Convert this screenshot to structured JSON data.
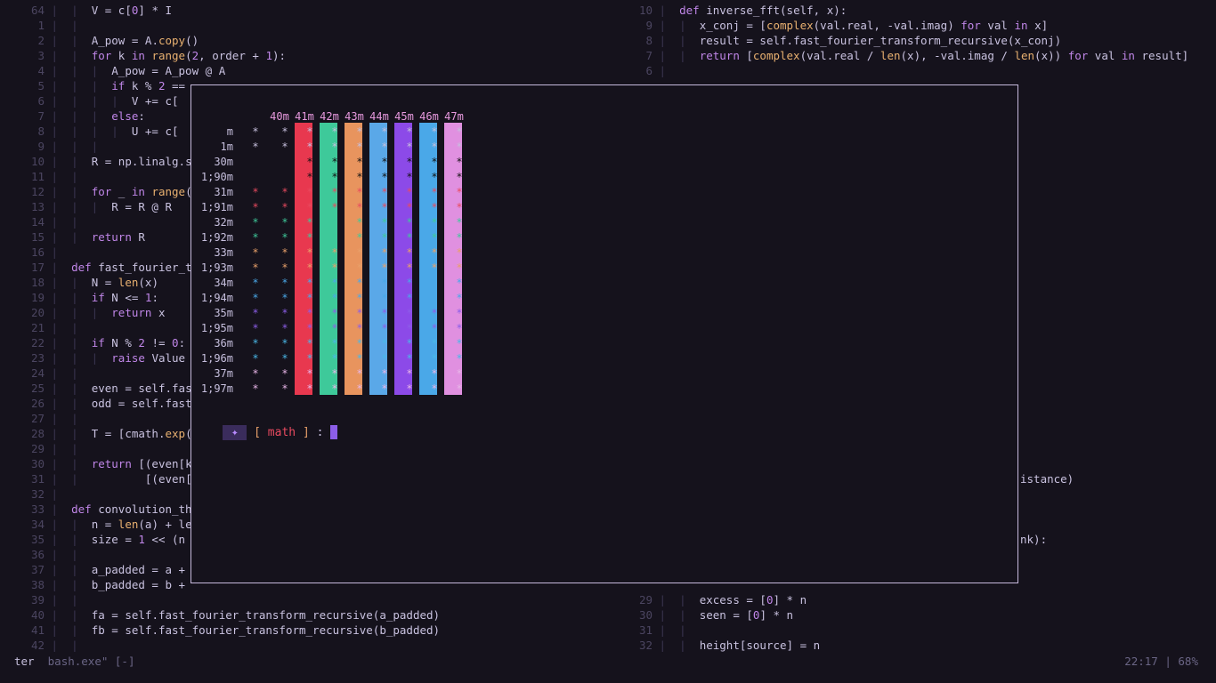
{
  "editor_left": {
    "lines": [
      {
        "n": "64",
        "indent": 1,
        "text": "V = c[0] * I"
      },
      {
        "n": "1",
        "indent": 1,
        "text": ""
      },
      {
        "n": "2",
        "indent": 1,
        "text": "A_pow = A.copy()"
      },
      {
        "n": "3",
        "indent": 1,
        "text": "for k in range(2, order + 1):"
      },
      {
        "n": "4",
        "indent": 2,
        "text": "A_pow = A_pow @ A"
      },
      {
        "n": "5",
        "indent": 2,
        "text": "if k % 2 =="
      },
      {
        "n": "6",
        "indent": 3,
        "text": "V += c["
      },
      {
        "n": "7",
        "indent": 2,
        "text": "else:"
      },
      {
        "n": "8",
        "indent": 3,
        "text": "U += c["
      },
      {
        "n": "9",
        "indent": 2,
        "text": ""
      },
      {
        "n": "10",
        "indent": 1,
        "text": "R = np.linalg.s"
      },
      {
        "n": "11",
        "indent": 1,
        "text": ""
      },
      {
        "n": "12",
        "indent": 1,
        "text": "for _ in range("
      },
      {
        "n": "13",
        "indent": 2,
        "text": "R = R @ R"
      },
      {
        "n": "14",
        "indent": 1,
        "text": ""
      },
      {
        "n": "15",
        "indent": 1,
        "text": "return R"
      },
      {
        "n": "16",
        "indent": 0,
        "text": ""
      },
      {
        "n": "17",
        "indent": 0,
        "text": "def fast_fourier_tr"
      },
      {
        "n": "18",
        "indent": 1,
        "text": "N = len(x)"
      },
      {
        "n": "19",
        "indent": 1,
        "text": "if N <= 1:"
      },
      {
        "n": "20",
        "indent": 2,
        "text": "return x"
      },
      {
        "n": "21",
        "indent": 1,
        "text": ""
      },
      {
        "n": "22",
        "indent": 1,
        "text": "if N % 2 != 0:"
      },
      {
        "n": "23",
        "indent": 2,
        "text": "raise Value"
      },
      {
        "n": "24",
        "indent": 1,
        "text": ""
      },
      {
        "n": "25",
        "indent": 1,
        "text": "even = self.fas"
      },
      {
        "n": "26",
        "indent": 1,
        "text": "odd = self.fast"
      },
      {
        "n": "27",
        "indent": 1,
        "text": ""
      },
      {
        "n": "28",
        "indent": 1,
        "text": "T = [cmath.exp("
      },
      {
        "n": "29",
        "indent": 1,
        "text": ""
      },
      {
        "n": "30",
        "indent": 1,
        "text": "return [(even[k"
      },
      {
        "n": "31",
        "indent": 1,
        "text": "        [(even[k"
      },
      {
        "n": "32",
        "indent": 0,
        "text": ""
      },
      {
        "n": "33",
        "indent": 0,
        "text": "def convolution_the"
      },
      {
        "n": "34",
        "indent": 1,
        "text": "n = len(a) + le"
      },
      {
        "n": "35",
        "indent": 1,
        "text": "size = 1 << (n"
      },
      {
        "n": "36",
        "indent": 1,
        "text": ""
      },
      {
        "n": "37",
        "indent": 1,
        "text": "a_padded = a +"
      },
      {
        "n": "38",
        "indent": 1,
        "text": "b_padded = b +"
      },
      {
        "n": "39",
        "indent": 1,
        "text": ""
      },
      {
        "n": "40",
        "indent": 1,
        "text": "fa = self.fast_fourier_transform_recursive(a_padded)"
      },
      {
        "n": "41",
        "indent": 1,
        "text": "fb = self.fast_fourier_transform_recursive(b_padded)"
      },
      {
        "n": "42",
        "indent": 1,
        "text": ""
      }
    ]
  },
  "editor_right": {
    "lines": [
      {
        "n": "10",
        "indent": 0,
        "text": "def inverse_fft(self, x):"
      },
      {
        "n": "9",
        "indent": 1,
        "text": "x_conj = [complex(val.real, -val.imag) for val in x]"
      },
      {
        "n": "8",
        "indent": 1,
        "text": "result = self.fast_fourier_transform_recursive(x_conj)"
      },
      {
        "n": "7",
        "indent": 1,
        "text": "return [complex(val.real / len(x), -val.imag / len(x)) for val in result]"
      },
      {
        "n": "6",
        "indent": 0,
        "text": ""
      }
    ],
    "fragments": [
      {
        "line": 31,
        "text": "istance)"
      },
      {
        "line": 35,
        "text": "nk):"
      }
    ],
    "bottom_lines": [
      {
        "n": "29",
        "indent": 1,
        "text": "excess = [0] * n"
      },
      {
        "n": "30",
        "indent": 1,
        "text": "seen = [0] * n"
      },
      {
        "n": "31",
        "indent": 1,
        "text": ""
      },
      {
        "n": "32",
        "indent": 1,
        "text": "height[source] = n"
      }
    ]
  },
  "color_test": {
    "column_headers": [
      "40m",
      "41m",
      "42m",
      "43m",
      "44m",
      "45m",
      "46m",
      "47m"
    ],
    "row_labels": [
      "m",
      "1m",
      "30m",
      "1;90m",
      "31m",
      "1;91m",
      "32m",
      "1;92m",
      "33m",
      "1;93m",
      "34m",
      "1;94m",
      "35m",
      "1;95m",
      "36m",
      "1;96m",
      "37m",
      "1;97m"
    ],
    "glyph": "*",
    "fg_colors": [
      "#c6bfdd",
      "#c6bfdd",
      "#111111",
      "#111111",
      "#e84a5f",
      "#e84a5f",
      "#3ec99a",
      "#3ec99a",
      "#e8a06a",
      "#e8a06a",
      "#4aa8e8",
      "#4aa8e8",
      "#8c5ee8",
      "#8c5ee8",
      "#4ab8e8",
      "#4ab8e8",
      "#e8b6e8",
      "#e8b6e8"
    ],
    "bg_colors": [
      "",
      "#e8384f",
      "#3ec99a",
      "#e8945e",
      "#5aa8e8",
      "#8c4ae8",
      "#4aa8e8",
      "#e090e0"
    ]
  },
  "prompt": {
    "icon": "sparkle-icon",
    "symbol": "✦",
    "open": "[",
    "name": "math",
    "close": "]",
    "sep": ":"
  },
  "status": {
    "left_active": "ter",
    "left_rest": "bash.exe\" [-]",
    "right": "22:17 | 68%"
  }
}
